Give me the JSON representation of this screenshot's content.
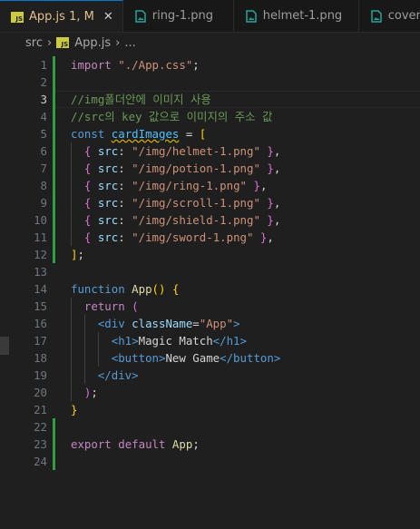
{
  "tabs": [
    {
      "label": "App.js",
      "status": "1, M",
      "icon": "js-icon",
      "active": true
    },
    {
      "label": "ring-1.png",
      "icon": "image-icon",
      "active": false
    },
    {
      "label": "helmet-1.png",
      "icon": "image-icon",
      "active": false
    },
    {
      "label": "cover.p",
      "icon": "image-icon",
      "active": false
    }
  ],
  "breadcrumb": {
    "folder": "src",
    "file": "App.js",
    "rest": "..."
  },
  "colors": {
    "accent": "#0078d4",
    "modified": "#e2c08d",
    "js_icon": "#cbcb41",
    "image_icon": "#26a69a",
    "git_added": "#2ea043"
  },
  "lines": [
    {
      "n": "1",
      "tokens": [
        [
          "kw2",
          "import"
        ],
        [
          "plain",
          " "
        ],
        [
          "str",
          "\"./App.css\""
        ],
        [
          "plain",
          ";"
        ]
      ]
    },
    {
      "n": "2",
      "tokens": []
    },
    {
      "n": "3",
      "tokens": [
        [
          "cm",
          "//img폴더안에 이미지 사용"
        ]
      ]
    },
    {
      "n": "4",
      "tokens": [
        [
          "cm",
          "//src의 key 값으로 이미지의 주소 값"
        ]
      ]
    },
    {
      "n": "5",
      "tokens": [
        [
          "kw",
          "const"
        ],
        [
          "plain",
          " "
        ],
        [
          "var sq",
          "cardImages"
        ],
        [
          "plain",
          " = "
        ],
        [
          "br1",
          "["
        ]
      ]
    },
    {
      "n": "6",
      "tokens": [
        [
          "plain",
          "  "
        ],
        [
          "br2",
          "{"
        ],
        [
          "plain",
          " "
        ],
        [
          "prop",
          "src"
        ],
        [
          "plain",
          ": "
        ],
        [
          "str",
          "\"/img/helmet-1.png\""
        ],
        [
          "plain",
          " "
        ],
        [
          "br2",
          "}"
        ],
        [
          "plain",
          ","
        ]
      ]
    },
    {
      "n": "7",
      "tokens": [
        [
          "plain",
          "  "
        ],
        [
          "br2",
          "{"
        ],
        [
          "plain",
          " "
        ],
        [
          "prop",
          "src"
        ],
        [
          "plain",
          ": "
        ],
        [
          "str",
          "\"/img/potion-1.png\""
        ],
        [
          "plain",
          " "
        ],
        [
          "br2",
          "}"
        ],
        [
          "plain",
          ","
        ]
      ]
    },
    {
      "n": "8",
      "tokens": [
        [
          "plain",
          "  "
        ],
        [
          "br2",
          "{"
        ],
        [
          "plain",
          " "
        ],
        [
          "prop",
          "src"
        ],
        [
          "plain",
          ": "
        ],
        [
          "str",
          "\"/img/ring-1.png\""
        ],
        [
          "plain",
          " "
        ],
        [
          "br2",
          "}"
        ],
        [
          "plain",
          ","
        ]
      ]
    },
    {
      "n": "9",
      "tokens": [
        [
          "plain",
          "  "
        ],
        [
          "br2",
          "{"
        ],
        [
          "plain",
          " "
        ],
        [
          "prop",
          "src"
        ],
        [
          "plain",
          ": "
        ],
        [
          "str",
          "\"/img/scroll-1.png\""
        ],
        [
          "plain",
          " "
        ],
        [
          "br2",
          "}"
        ],
        [
          "plain",
          ","
        ]
      ]
    },
    {
      "n": "10",
      "tokens": [
        [
          "plain",
          "  "
        ],
        [
          "br2",
          "{"
        ],
        [
          "plain",
          " "
        ],
        [
          "prop",
          "src"
        ],
        [
          "plain",
          ": "
        ],
        [
          "str",
          "\"/img/shield-1.png\""
        ],
        [
          "plain",
          " "
        ],
        [
          "br2",
          "}"
        ],
        [
          "plain",
          ","
        ]
      ]
    },
    {
      "n": "11",
      "tokens": [
        [
          "plain",
          "  "
        ],
        [
          "br2",
          "{"
        ],
        [
          "plain",
          " "
        ],
        [
          "prop",
          "src"
        ],
        [
          "plain",
          ": "
        ],
        [
          "str",
          "\"/img/sword-1.png\""
        ],
        [
          "plain",
          " "
        ],
        [
          "br2",
          "}"
        ],
        [
          "plain",
          ","
        ]
      ]
    },
    {
      "n": "12",
      "tokens": [
        [
          "br1",
          "]"
        ],
        [
          "plain",
          ";"
        ]
      ]
    },
    {
      "n": "13",
      "tokens": []
    },
    {
      "n": "14",
      "tokens": [
        [
          "kw",
          "function"
        ],
        [
          "plain",
          " "
        ],
        [
          "fn",
          "App"
        ],
        [
          "br1",
          "()"
        ],
        [
          "plain",
          " "
        ],
        [
          "br1",
          "{"
        ]
      ]
    },
    {
      "n": "15",
      "tokens": [
        [
          "plain",
          "  "
        ],
        [
          "kw2",
          "return"
        ],
        [
          "plain",
          " "
        ],
        [
          "br2",
          "("
        ]
      ]
    },
    {
      "n": "16",
      "tokens": [
        [
          "plain",
          "    "
        ],
        [
          "tag",
          "<div"
        ],
        [
          "plain",
          " "
        ],
        [
          "attr",
          "className"
        ],
        [
          "plain",
          "="
        ],
        [
          "str",
          "\"App\""
        ],
        [
          "tag",
          ">"
        ]
      ]
    },
    {
      "n": "17",
      "tokens": [
        [
          "plain",
          "      "
        ],
        [
          "tag",
          "<h1>"
        ],
        [
          "plain",
          "Magic Match"
        ],
        [
          "tag",
          "</h1>"
        ]
      ]
    },
    {
      "n": "18",
      "tokens": [
        [
          "plain",
          "      "
        ],
        [
          "tag",
          "<button>"
        ],
        [
          "plain",
          "New Game"
        ],
        [
          "tag",
          "</button>"
        ]
      ]
    },
    {
      "n": "19",
      "tokens": [
        [
          "plain",
          "    "
        ],
        [
          "tag",
          "</div>"
        ]
      ]
    },
    {
      "n": "20",
      "tokens": [
        [
          "plain",
          "  "
        ],
        [
          "br2",
          ")"
        ],
        [
          "plain",
          ";"
        ]
      ]
    },
    {
      "n": "21",
      "tokens": [
        [
          "br1",
          "}"
        ]
      ]
    },
    {
      "n": "22",
      "tokens": []
    },
    {
      "n": "23",
      "tokens": [
        [
          "kw2",
          "export"
        ],
        [
          "plain",
          " "
        ],
        [
          "kw2",
          "default"
        ],
        [
          "plain",
          " "
        ],
        [
          "fn",
          "App"
        ],
        [
          "plain",
          ";"
        ]
      ]
    },
    {
      "n": "24",
      "tokens": []
    }
  ],
  "current_line": "3"
}
